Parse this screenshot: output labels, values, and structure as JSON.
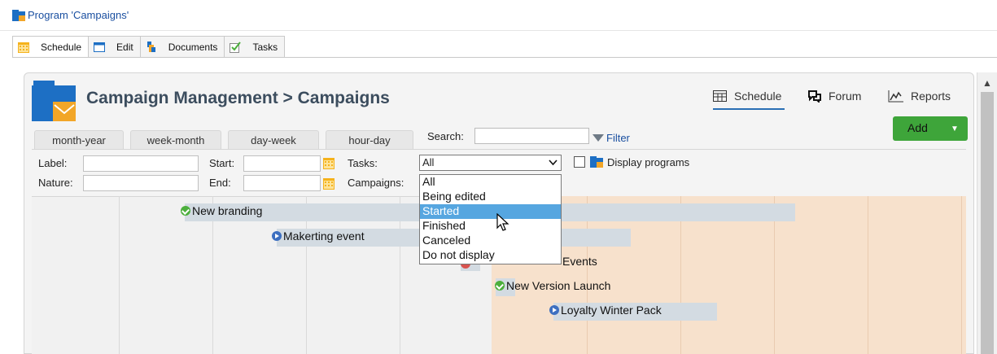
{
  "window": {
    "title": "Program 'Campaigns'"
  },
  "tabs": [
    {
      "label": "Schedule",
      "icon": "calendar-icon",
      "active": true
    },
    {
      "label": "Edit",
      "icon": "edit-window-icon",
      "active": false
    },
    {
      "label": "Documents",
      "icon": "documents-icon",
      "active": false
    },
    {
      "label": "Tasks",
      "icon": "tasks-checkbox-icon",
      "active": false
    }
  ],
  "header": {
    "title": "Campaign Management > Campaigns"
  },
  "view_links": [
    {
      "label": "Schedule",
      "icon": "schedule-grid-icon",
      "active": true
    },
    {
      "label": "Forum",
      "icon": "forum-icon",
      "active": false
    },
    {
      "label": "Reports",
      "icon": "reports-chart-icon",
      "active": false
    }
  ],
  "add_button": {
    "label": "Add"
  },
  "time_tabs": [
    "month-year",
    "week-month",
    "day-week",
    "hour-day"
  ],
  "search": {
    "label": "Search:",
    "value": "",
    "filter_label": "Filter"
  },
  "form": {
    "label_lbl": "Label:",
    "nature_lbl": "Nature:",
    "start_lbl": "Start:",
    "end_lbl": "End:",
    "tasks_lbl": "Tasks:",
    "campaigns_lbl": "Campaigns:",
    "tasks_value": "All",
    "display_programs": "Display programs"
  },
  "task_options": [
    "All",
    "Being edited",
    "Started",
    "Finished",
    "Canceled",
    "Do not display"
  ],
  "selected_option": "Started",
  "campaigns": [
    {
      "label": "New branding",
      "status": "finished"
    },
    {
      "label": "Makerting event",
      "status": "started"
    },
    {
      "label": "Events",
      "status": "canceled"
    },
    {
      "label": "New Version Launch",
      "status": "finished"
    },
    {
      "label": "Loyalty Winter Pack",
      "status": "started"
    }
  ],
  "colors": {
    "add_button": "#3ea53a",
    "selected_option": "#56a6e0",
    "link": "#1a4fa0",
    "peach_band": "#f7e1cc"
  }
}
